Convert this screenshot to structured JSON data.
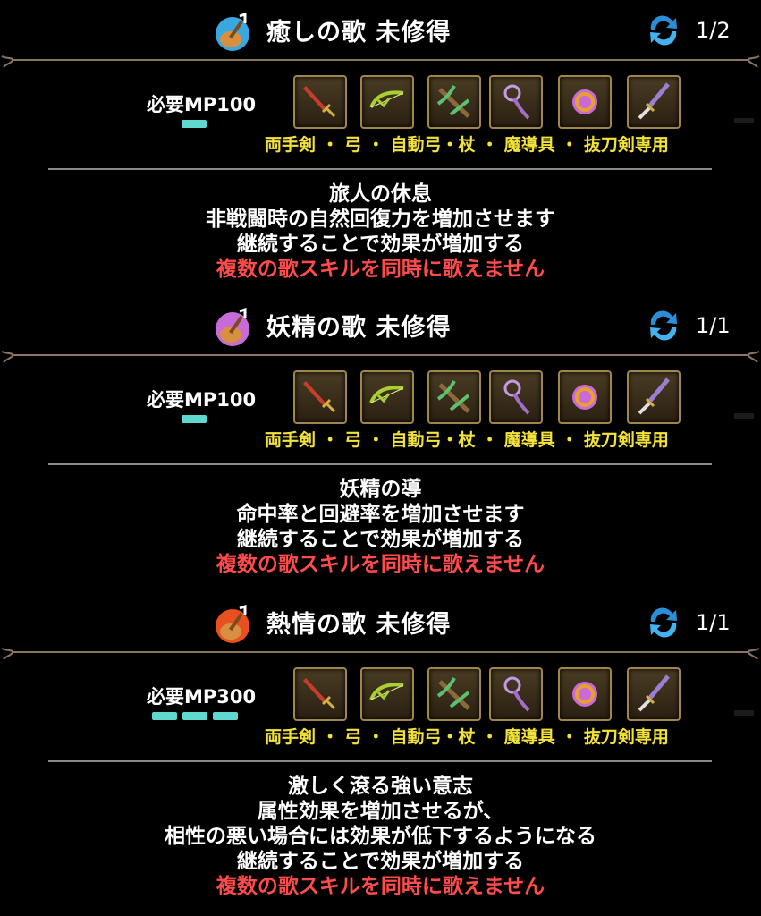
{
  "songs": [
    {
      "title": "癒しの歌 未修得",
      "level": "1/2",
      "mp": "必要MP100",
      "mp_bars": 1,
      "weapons": "両手剣 ・ 弓 ・ 自動弓・杖 ・ 魔導具 ・ 抜刀剣専用",
      "desc": [
        "旅人の休息",
        "非戦闘時の自然回復力を増加させます",
        "継続することで効果が増加する"
      ],
      "warning": "複数の歌スキルを同時に歌えません",
      "icon_color": "#3aa8e0",
      "icon": "guitar-note-icon"
    },
    {
      "title": "妖精の歌 未修得",
      "level": "1/1",
      "mp": "必要MP100",
      "mp_bars": 1,
      "weapons": "両手剣 ・ 弓 ・ 自動弓・杖 ・ 魔導具 ・ 抜刀剣専用",
      "desc": [
        "妖精の導",
        "命中率と回避率を増加させます",
        "継続することで効果が増加する"
      ],
      "warning": "複数の歌スキルを同時に歌えません",
      "icon_color": "#c86ad8",
      "icon": "guitar-note-icon"
    },
    {
      "title": "熱情の歌 未修得",
      "level": "1/1",
      "mp": "必要MP300",
      "mp_bars": 3,
      "weapons": "両手剣 ・ 弓 ・ 自動弓・杖 ・ 魔導具 ・ 抜刀剣専用",
      "desc": [
        "激しく滾る強い意志",
        "属性効果を増加させるが、",
        "相性の悪い場合には効果が低下するようになる",
        "継続することで効果が増加する"
      ],
      "warning": "複数の歌スキルを同時に歌えません",
      "icon_color": "#e85020",
      "icon": "guitar-note-icon"
    }
  ],
  "weapon_icons": [
    "sword-icon",
    "bow-icon",
    "crossbow-icon",
    "staff-icon",
    "magic-ring-icon",
    "katana-icon"
  ],
  "colors": {
    "accent_mp": "#5fd8d0",
    "weapon_text": "#f2e23a",
    "warning": "#ff4b4b",
    "frame": "#8a7560"
  }
}
